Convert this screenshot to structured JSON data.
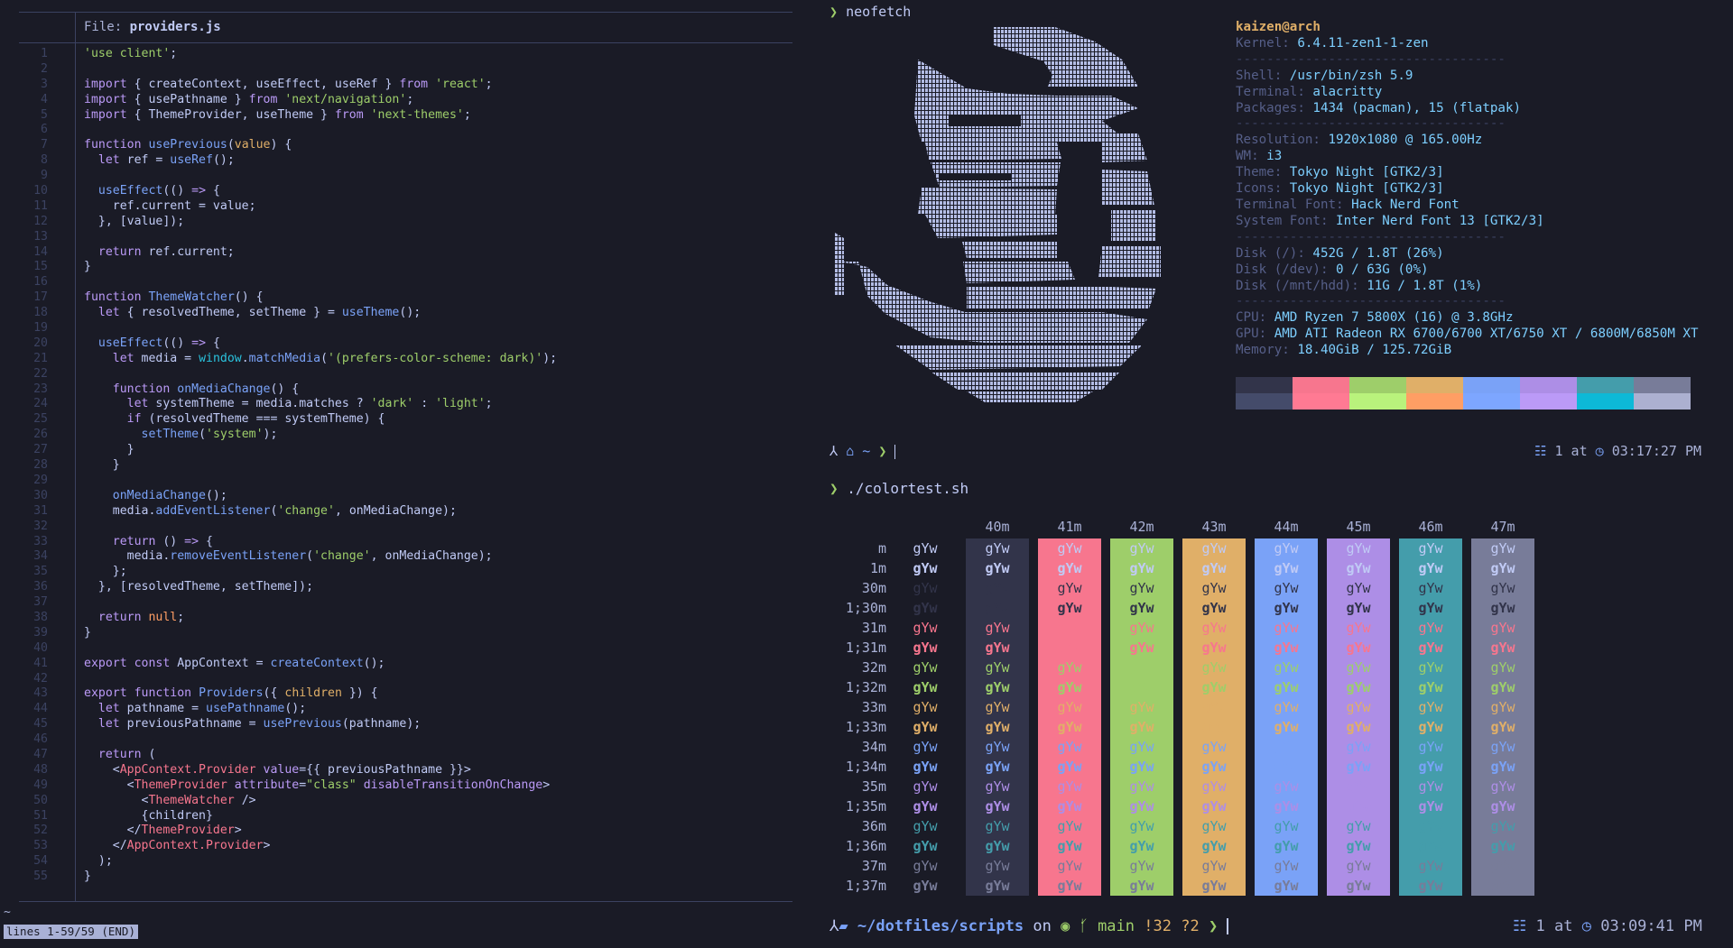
{
  "editor": {
    "file_label": "File: ",
    "file_name": "providers.js",
    "status": "lines 1-59/59 (END)",
    "tilde": "~",
    "lines": [
      {
        "n": "1",
        "segs": [
          [
            "str",
            "'use client'"
          ],
          [
            "pl",
            ";"
          ]
        ]
      },
      {
        "n": "2",
        "segs": []
      },
      {
        "n": "3",
        "segs": [
          [
            "kw",
            "import"
          ],
          [
            "pl",
            " { createContext, useEffect, useRef } "
          ],
          [
            "kw",
            "from"
          ],
          [
            "pl",
            " "
          ],
          [
            "str",
            "'react'"
          ],
          [
            "pl",
            ";"
          ]
        ]
      },
      {
        "n": "4",
        "segs": [
          [
            "kw",
            "import"
          ],
          [
            "pl",
            " { usePathname } "
          ],
          [
            "kw",
            "from"
          ],
          [
            "pl",
            " "
          ],
          [
            "str",
            "'next/navigation'"
          ],
          [
            "pl",
            ";"
          ]
        ]
      },
      {
        "n": "5",
        "segs": [
          [
            "kw",
            "import"
          ],
          [
            "pl",
            " { ThemeProvider, useTheme } "
          ],
          [
            "kw",
            "from"
          ],
          [
            "pl",
            " "
          ],
          [
            "str",
            "'next-themes'"
          ],
          [
            "pl",
            ";"
          ]
        ]
      },
      {
        "n": "6",
        "segs": []
      },
      {
        "n": "7",
        "segs": [
          [
            "kw",
            "function"
          ],
          [
            "pl",
            " "
          ],
          [
            "fn",
            "usePrevious"
          ],
          [
            "pl",
            "("
          ],
          [
            "yel",
            "value"
          ],
          [
            "pl",
            ") {"
          ]
        ]
      },
      {
        "n": "8",
        "segs": [
          [
            "pl",
            "  "
          ],
          [
            "kw",
            "let"
          ],
          [
            "pl",
            " ref = "
          ],
          [
            "fn",
            "useRef"
          ],
          [
            "pl",
            "();"
          ]
        ]
      },
      {
        "n": "9",
        "segs": []
      },
      {
        "n": "10",
        "segs": [
          [
            "pl",
            "  "
          ],
          [
            "fn",
            "useEffect"
          ],
          [
            "pl",
            "(() "
          ],
          [
            "kw",
            "=>"
          ],
          [
            "pl",
            " {"
          ]
        ]
      },
      {
        "n": "11",
        "segs": [
          [
            "pl",
            "    ref.current = value;"
          ]
        ]
      },
      {
        "n": "12",
        "segs": [
          [
            "pl",
            "  }, [value]);"
          ]
        ]
      },
      {
        "n": "13",
        "segs": []
      },
      {
        "n": "14",
        "segs": [
          [
            "pl",
            "  "
          ],
          [
            "kw",
            "return"
          ],
          [
            "pl",
            " ref.current;"
          ]
        ]
      },
      {
        "n": "15",
        "segs": [
          [
            "pl",
            "}"
          ]
        ]
      },
      {
        "n": "16",
        "segs": []
      },
      {
        "n": "17",
        "segs": [
          [
            "kw",
            "function"
          ],
          [
            "pl",
            " "
          ],
          [
            "fn",
            "ThemeWatcher"
          ],
          [
            "pl",
            "() {"
          ]
        ]
      },
      {
        "n": "18",
        "segs": [
          [
            "pl",
            "  "
          ],
          [
            "kw",
            "let"
          ],
          [
            "pl",
            " { resolvedTheme, setTheme } = "
          ],
          [
            "fn",
            "useTheme"
          ],
          [
            "pl",
            "();"
          ]
        ]
      },
      {
        "n": "19",
        "segs": []
      },
      {
        "n": "20",
        "segs": [
          [
            "pl",
            "  "
          ],
          [
            "fn",
            "useEffect"
          ],
          [
            "pl",
            "(() "
          ],
          [
            "kw",
            "=>"
          ],
          [
            "pl",
            " {"
          ]
        ]
      },
      {
        "n": "21",
        "segs": [
          [
            "pl",
            "    "
          ],
          [
            "kw",
            "let"
          ],
          [
            "pl",
            " media = "
          ],
          [
            "teal",
            "window"
          ],
          [
            "pl",
            "."
          ],
          [
            "fn",
            "matchMedia"
          ],
          [
            "pl",
            "("
          ],
          [
            "str",
            "'(prefers-color-scheme: dark)'"
          ],
          [
            "pl",
            ");"
          ]
        ]
      },
      {
        "n": "22",
        "segs": []
      },
      {
        "n": "23",
        "segs": [
          [
            "pl",
            "    "
          ],
          [
            "kw",
            "function"
          ],
          [
            "pl",
            " "
          ],
          [
            "fn",
            "onMediaChange"
          ],
          [
            "pl",
            "() {"
          ]
        ]
      },
      {
        "n": "24",
        "segs": [
          [
            "pl",
            "      "
          ],
          [
            "kw",
            "let"
          ],
          [
            "pl",
            " systemTheme = media.matches ? "
          ],
          [
            "str",
            "'dark'"
          ],
          [
            "pl",
            " : "
          ],
          [
            "str",
            "'light'"
          ],
          [
            "pl",
            ";"
          ]
        ]
      },
      {
        "n": "25",
        "segs": [
          [
            "pl",
            "      "
          ],
          [
            "kw",
            "if"
          ],
          [
            "pl",
            " (resolvedTheme === systemTheme) {"
          ]
        ]
      },
      {
        "n": "26",
        "segs": [
          [
            "pl",
            "        "
          ],
          [
            "fn",
            "setTheme"
          ],
          [
            "pl",
            "("
          ],
          [
            "str",
            "'system'"
          ],
          [
            "pl",
            ");"
          ]
        ]
      },
      {
        "n": "27",
        "segs": [
          [
            "pl",
            "      }"
          ]
        ]
      },
      {
        "n": "28",
        "segs": [
          [
            "pl",
            "    }"
          ]
        ]
      },
      {
        "n": "29",
        "segs": []
      },
      {
        "n": "30",
        "segs": [
          [
            "pl",
            "    "
          ],
          [
            "fn",
            "onMediaChange"
          ],
          [
            "pl",
            "();"
          ]
        ]
      },
      {
        "n": "31",
        "segs": [
          [
            "pl",
            "    media."
          ],
          [
            "fn",
            "addEventListener"
          ],
          [
            "pl",
            "("
          ],
          [
            "str",
            "'change'"
          ],
          [
            "pl",
            ", onMediaChange);"
          ]
        ]
      },
      {
        "n": "32",
        "segs": []
      },
      {
        "n": "33",
        "segs": [
          [
            "pl",
            "    "
          ],
          [
            "kw",
            "return"
          ],
          [
            "pl",
            " () "
          ],
          [
            "kw",
            "=>"
          ],
          [
            "pl",
            " {"
          ]
        ]
      },
      {
        "n": "34",
        "segs": [
          [
            "pl",
            "      media."
          ],
          [
            "fn",
            "removeEventListener"
          ],
          [
            "pl",
            "("
          ],
          [
            "str",
            "'change'"
          ],
          [
            "pl",
            ", onMediaChange);"
          ]
        ]
      },
      {
        "n": "35",
        "segs": [
          [
            "pl",
            "    };"
          ]
        ]
      },
      {
        "n": "36",
        "segs": [
          [
            "pl",
            "  }, [resolvedTheme, setTheme]);"
          ]
        ]
      },
      {
        "n": "37",
        "segs": []
      },
      {
        "n": "38",
        "segs": [
          [
            "pl",
            "  "
          ],
          [
            "kw",
            "return"
          ],
          [
            "pl",
            " "
          ],
          [
            "org",
            "null"
          ],
          [
            "pl",
            ";"
          ]
        ]
      },
      {
        "n": "39",
        "segs": [
          [
            "pl",
            "}"
          ]
        ]
      },
      {
        "n": "40",
        "segs": []
      },
      {
        "n": "41",
        "segs": [
          [
            "kw",
            "export"
          ],
          [
            "pl",
            " "
          ],
          [
            "kw",
            "const"
          ],
          [
            "pl",
            " AppContext = "
          ],
          [
            "fn",
            "createContext"
          ],
          [
            "pl",
            "();"
          ]
        ]
      },
      {
        "n": "42",
        "segs": []
      },
      {
        "n": "43",
        "segs": [
          [
            "kw",
            "export"
          ],
          [
            "pl",
            " "
          ],
          [
            "kw",
            "function"
          ],
          [
            "pl",
            " "
          ],
          [
            "fn",
            "Providers"
          ],
          [
            "pl",
            "({ "
          ],
          [
            "yel",
            "children"
          ],
          [
            "pl",
            " }) {"
          ]
        ]
      },
      {
        "n": "44",
        "segs": [
          [
            "pl",
            "  "
          ],
          [
            "kw",
            "let"
          ],
          [
            "pl",
            " pathname = "
          ],
          [
            "fn",
            "usePathname"
          ],
          [
            "pl",
            "();"
          ]
        ]
      },
      {
        "n": "45",
        "segs": [
          [
            "pl",
            "  "
          ],
          [
            "kw",
            "let"
          ],
          [
            "pl",
            " previousPathname = "
          ],
          [
            "fn",
            "usePrevious"
          ],
          [
            "pl",
            "(pathname);"
          ]
        ]
      },
      {
        "n": "46",
        "segs": []
      },
      {
        "n": "47",
        "segs": [
          [
            "pl",
            "  "
          ],
          [
            "kw",
            "return"
          ],
          [
            "pl",
            " ("
          ]
        ]
      },
      {
        "n": "48",
        "segs": [
          [
            "pl",
            "    <"
          ],
          [
            "tag",
            "AppContext.Provider"
          ],
          [
            "pl",
            " "
          ],
          [
            "kw",
            "value"
          ],
          [
            "pl",
            "={{ previousPathname }}>"
          ]
        ]
      },
      {
        "n": "49",
        "segs": [
          [
            "pl",
            "      <"
          ],
          [
            "tag",
            "ThemeProvider"
          ],
          [
            "pl",
            " "
          ],
          [
            "kw",
            "attribute"
          ],
          [
            "pl",
            "="
          ],
          [
            "str",
            "\"class\""
          ],
          [
            "pl",
            " "
          ],
          [
            "kw",
            "disableTransitionOnChange"
          ],
          [
            "pl",
            ">"
          ]
        ]
      },
      {
        "n": "50",
        "segs": [
          [
            "pl",
            "        <"
          ],
          [
            "tag",
            "ThemeWatcher"
          ],
          [
            "pl",
            " />"
          ]
        ]
      },
      {
        "n": "51",
        "segs": [
          [
            "pl",
            "        {children}"
          ]
        ]
      },
      {
        "n": "52",
        "segs": [
          [
            "pl",
            "      </"
          ],
          [
            "tag",
            "ThemeProvider"
          ],
          [
            "pl",
            ">"
          ]
        ]
      },
      {
        "n": "53",
        "segs": [
          [
            "pl",
            "    </"
          ],
          [
            "tag",
            "AppContext.Provider"
          ],
          [
            "pl",
            ">"
          ]
        ]
      },
      {
        "n": "54",
        "segs": [
          [
            "pl",
            "  );"
          ]
        ]
      },
      {
        "n": "55",
        "segs": [
          [
            "pl",
            "}"
          ]
        ]
      }
    ]
  },
  "terminal": {
    "cmd1_prompt": "❯ ",
    "cmd1": "neofetch",
    "neofetch": {
      "user": "kaizen@arch",
      "rows": [
        {
          "k": "Kernel: ",
          "v": "6.4.11-zen1-1-zen"
        },
        {
          "sep": "-----------------------------------"
        },
        {
          "k": "Shell: ",
          "v": "/usr/bin/zsh 5.9"
        },
        {
          "k": "Terminal: ",
          "v": "alacritty"
        },
        {
          "k": "Packages: ",
          "v": "1434 (pacman), 15 (flatpak)"
        },
        {
          "sep": "-----------------------------------"
        },
        {
          "k": "Resolution: ",
          "v": "1920x1080 @ 165.00Hz"
        },
        {
          "k": "WM: ",
          "v": "i3"
        },
        {
          "k": "Theme: ",
          "v": "Tokyo Night [GTK2/3]"
        },
        {
          "k": "Icons: ",
          "v": "Tokyo Night [GTK2/3]"
        },
        {
          "k": "Terminal Font: ",
          "v": "Hack Nerd Font"
        },
        {
          "k": "System Font: ",
          "v": "Inter Nerd Font 13 [GTK2/3]"
        },
        {
          "sep": "-----------------------------------"
        },
        {
          "k": "Disk (/): ",
          "v": "452G / 1.8T (26%)"
        },
        {
          "k": "Disk (/dev): ",
          "v": "0 / 63G (0%)"
        },
        {
          "k": "Disk (/mnt/hdd): ",
          "v": "11G / 1.8T (1%)"
        },
        {
          "sep": "-----------------------------------"
        },
        {
          "k": "CPU: ",
          "v": "AMD Ryzen 7 5800X (16) @ 3.8GHz"
        },
        {
          "k": "GPU: ",
          "v": "AMD ATI Radeon RX 6700/6700 XT/6750 XT / 6800M/6850M XT"
        },
        {
          "k": "Memory: ",
          "v": "18.40GiB / 125.72GiB"
        }
      ],
      "palette_top": [
        "#32344a",
        "#f7768e",
        "#9ece6a",
        "#e0af68",
        "#7aa2f7",
        "#ad8ee6",
        "#449dab",
        "#787c99"
      ],
      "palette_bottom": [
        "#444b6a",
        "#ff7a93",
        "#b9f27c",
        "#ff9e64",
        "#7da6ff",
        "#bb9af7",
        "#0db9d7",
        "#acb0d0"
      ]
    },
    "prompt2": {
      "dir": "~",
      "arrow": "❯",
      "status_num": "1",
      "status_at": "at",
      "time": "03:17:27 PM"
    },
    "cmd2_prompt": "❯ ",
    "cmd2": "./colortest.sh",
    "colortest": {
      "headers": [
        "40m",
        "41m",
        "42m",
        "43m",
        "44m",
        "45m",
        "46m",
        "47m"
      ],
      "bgs": [
        "#32344a",
        "#f7768e",
        "#9ece6a",
        "#e0af68",
        "#7aa2f7",
        "#ad8ee6",
        "#449dab",
        "#787c99"
      ],
      "rows": [
        {
          "label": "m",
          "fg": "#c0caf5",
          "bold": false
        },
        {
          "label": "1m",
          "fg": "#c0caf5",
          "bold": true
        },
        {
          "label": "30m",
          "fg": "#32344a",
          "bold": false
        },
        {
          "label": "1;30m",
          "fg": "#32344a",
          "bold": true
        },
        {
          "label": "31m",
          "fg": "#f7768e",
          "bold": false
        },
        {
          "label": "1;31m",
          "fg": "#f7768e",
          "bold": true
        },
        {
          "label": "32m",
          "fg": "#9ece6a",
          "bold": false
        },
        {
          "label": "1;32m",
          "fg": "#9ece6a",
          "bold": true
        },
        {
          "label": "33m",
          "fg": "#e0af68",
          "bold": false
        },
        {
          "label": "1;33m",
          "fg": "#e0af68",
          "bold": true
        },
        {
          "label": "34m",
          "fg": "#7aa2f7",
          "bold": false
        },
        {
          "label": "1;34m",
          "fg": "#7aa2f7",
          "bold": true
        },
        {
          "label": "35m",
          "fg": "#ad8ee6",
          "bold": false
        },
        {
          "label": "1;35m",
          "fg": "#ad8ee6",
          "bold": true
        },
        {
          "label": "36m",
          "fg": "#449dab",
          "bold": false
        },
        {
          "label": "1;36m",
          "fg": "#449dab",
          "bold": true
        },
        {
          "label": "37m",
          "fg": "#787c99",
          "bold": false
        },
        {
          "label": "1;37m",
          "fg": "#787c99",
          "bold": true
        }
      ],
      "sample": "gYw"
    },
    "prompt3": {
      "path": "~/dotfiles/scripts",
      "on": "on",
      "branch": "main",
      "changes": "!32",
      "untracked": "?2",
      "arrow": "❯",
      "status_num": "1",
      "status_at": "at",
      "time": "03:09:41 PM"
    }
  },
  "colors": {
    "bg": "#1a1b26",
    "fg": "#c0caf5",
    "accent": "#7aa2f7",
    "green": "#9ece6a",
    "muted": "#565f89"
  }
}
